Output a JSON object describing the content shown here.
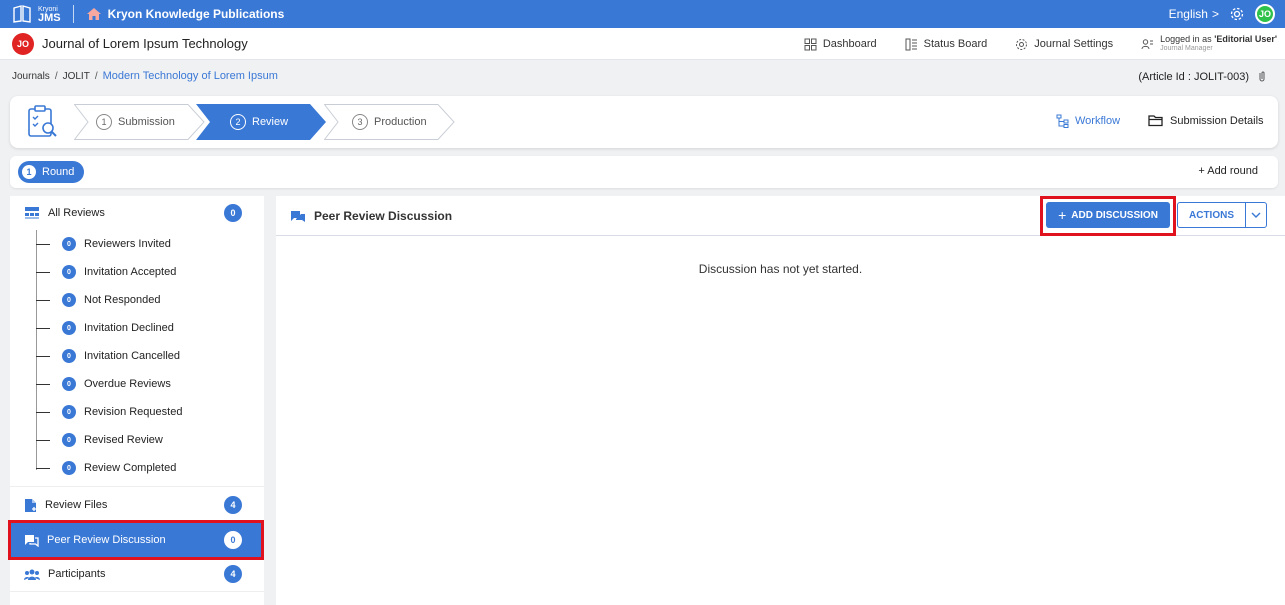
{
  "topbar": {
    "brand_small": "Kryoni",
    "brand_big": "JMS",
    "publication": "Kryon Knowledge Publications",
    "language": "English",
    "language_caret": ">",
    "avatar": "JO"
  },
  "journalbar": {
    "badge": "JO",
    "title": "Journal of Lorem Ipsum Technology",
    "nav": [
      "Dashboard",
      "Status Board",
      "Journal Settings"
    ],
    "logged_prefix": "Logged in as ",
    "logged_role": "'Editorial User'",
    "logged_sub": "Journal Manager"
  },
  "breadcrumb": {
    "items": [
      "Journals",
      "JOLIT",
      "Modern Technology of Lorem Ipsum"
    ],
    "sep": "/",
    "article_id": "(Article Id : JOLIT-003)"
  },
  "stepper": {
    "steps": [
      {
        "num": "1",
        "label": "Submission"
      },
      {
        "num": "2",
        "label": "Review"
      },
      {
        "num": "3",
        "label": "Production"
      }
    ],
    "workflow": "Workflow",
    "submission_details": "Submission Details"
  },
  "rounds": {
    "round_num": "1",
    "round_label": "Round",
    "add_round": "+ Add round"
  },
  "sidebar": {
    "all_reviews": {
      "label": "All Reviews",
      "count": "0"
    },
    "sub_items": [
      {
        "label": "Reviewers Invited",
        "count": "0"
      },
      {
        "label": "Invitation Accepted",
        "count": "0"
      },
      {
        "label": "Not Responded",
        "count": "0"
      },
      {
        "label": "Invitation Declined",
        "count": "0"
      },
      {
        "label": "Invitation Cancelled",
        "count": "0"
      },
      {
        "label": "Overdue Reviews",
        "count": "0"
      },
      {
        "label": "Revision Requested",
        "count": "0"
      },
      {
        "label": "Revised Review",
        "count": "0"
      },
      {
        "label": "Review Completed",
        "count": "0"
      }
    ],
    "review_files": {
      "label": "Review Files",
      "count": "4"
    },
    "peer_review": {
      "label": "Peer Review Discussion",
      "count": "0"
    },
    "participants": {
      "label": "Participants",
      "count": "4"
    }
  },
  "main": {
    "title": "Peer Review Discussion",
    "add_discussion": "ADD DISCUSSION",
    "add_plus": "+",
    "actions": "ACTIONS",
    "empty_message": "Discussion has not yet started."
  },
  "colors": {
    "primary": "#3a78d6",
    "highlight": "#e0121e",
    "avatar_green": "#2ec24a",
    "badge_red": "#e02424"
  },
  "icons": [
    "book-logo-icon",
    "home-icon",
    "gear-icon",
    "dashboard-icon",
    "status-board-icon",
    "settings-icon",
    "user-icon",
    "clip-icon",
    "clipboard-icon",
    "workflow-icon",
    "folder-icon",
    "reviews-icon",
    "file-icon",
    "chat-icon",
    "people-icon",
    "chevron-down-icon"
  ]
}
